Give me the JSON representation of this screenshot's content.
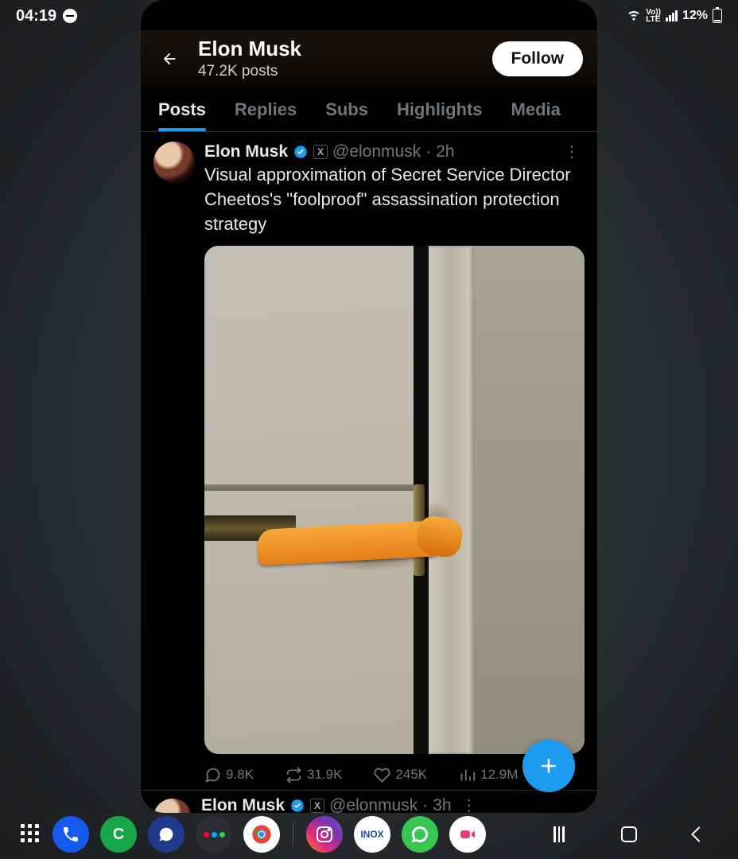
{
  "statusbar": {
    "time": "04:19",
    "lte": "Vo))\nLTE",
    "battery_text": "12%"
  },
  "header": {
    "title": "Elon Musk",
    "subtitle": "47.2K posts",
    "follow_label": "Follow"
  },
  "tabs": [
    {
      "label": "Posts",
      "active": true
    },
    {
      "label": "Replies",
      "active": false
    },
    {
      "label": "Subs",
      "active": false
    },
    {
      "label": "Highlights",
      "active": false
    },
    {
      "label": "Media",
      "active": false
    }
  ],
  "post": {
    "display_name": "Elon Musk",
    "x_badge": "X",
    "handle": "@elonmusk",
    "sep": " · ",
    "time": "2h",
    "text": "Visual approximation of Secret Service Director Cheetos's \"foolproof\" assassination protection strategy",
    "actions": {
      "reply": "9.8K",
      "retweet": "31.9K",
      "like": "245K",
      "views": "12.9M"
    }
  },
  "post2": {
    "display_name": "Elon Musk",
    "x_badge": "X",
    "handle": "@elonmusk",
    "sep": " · ",
    "time": "3h"
  },
  "taskbar": {
    "inox": "INOX"
  }
}
